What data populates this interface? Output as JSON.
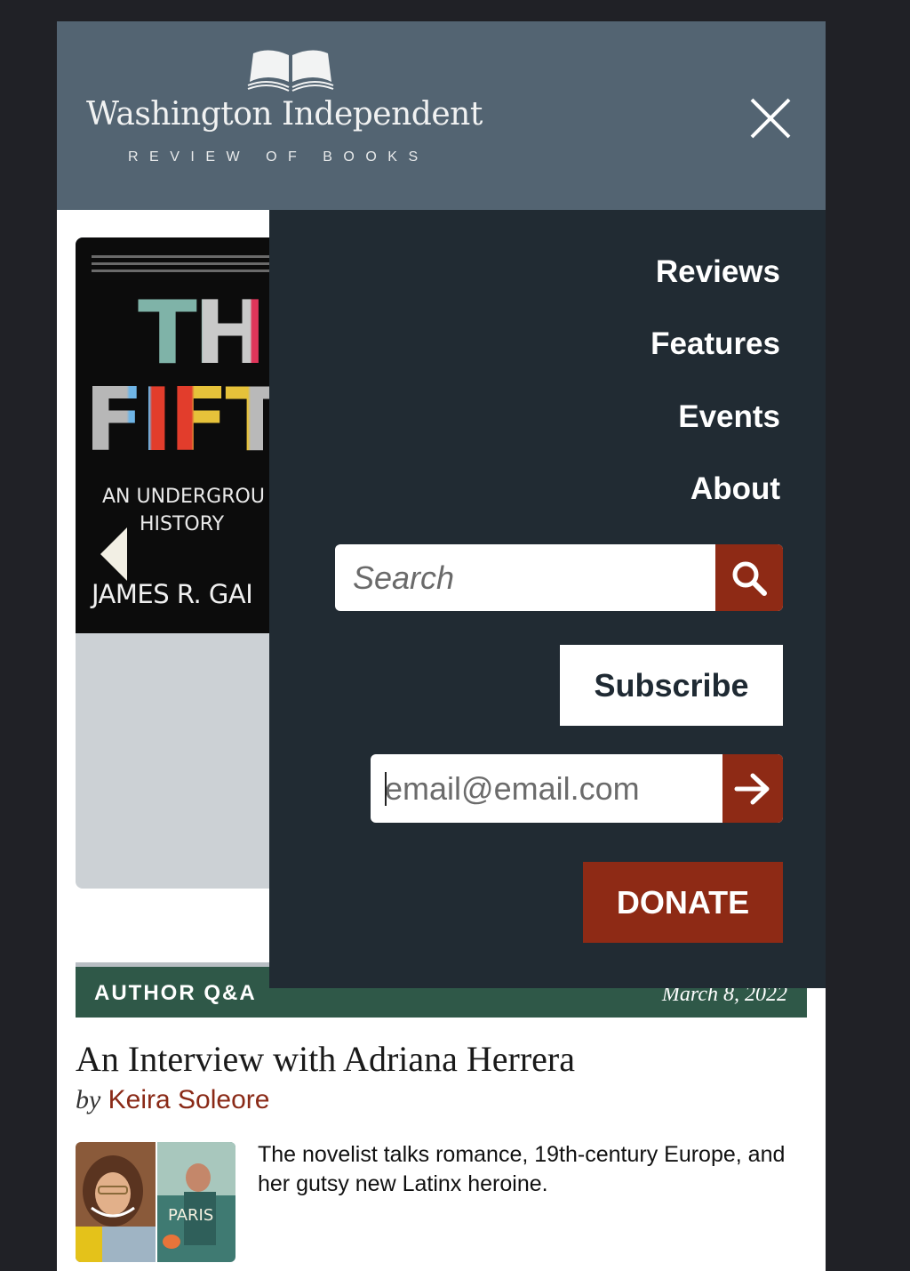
{
  "header": {
    "logo_title": "Washington Independent",
    "logo_subtitle": "REVIEW OF BOOKS"
  },
  "hero": {
    "cover_title_line1": "THE",
    "cover_title_line2": "FIFTIE",
    "cover_subtitle": "AN UNDERGROU\n      HISTORY",
    "cover_author": "JAMES R. GAI"
  },
  "menu": {
    "items": [
      {
        "label": "Reviews"
      },
      {
        "label": "Features"
      },
      {
        "label": "Events"
      },
      {
        "label": "About"
      }
    ],
    "search_placeholder": "Search",
    "subscribe_label": "Subscribe",
    "email_placeholder": "email@email.com",
    "donate_label": "DONATE"
  },
  "article": {
    "section_label": "AUTHOR Q&A",
    "date": "March 8, 2022",
    "title": "An Interview with Adriana Herrera",
    "by_word": "by",
    "author": "Keira Soleore",
    "excerpt": "The novelist talks romance, 19th-century Europe, and her gutsy new Latinx heroine.",
    "thumb_book_text": "PARIS"
  },
  "colors": {
    "header_bg": "#536472",
    "menu_bg": "#212b33",
    "accent": "#8e2a15",
    "section_bar": "#2f5848"
  },
  "icons": [
    "open-book-logo-icon",
    "close-icon",
    "chevron-left-icon",
    "search-icon",
    "arrow-right-icon"
  ]
}
